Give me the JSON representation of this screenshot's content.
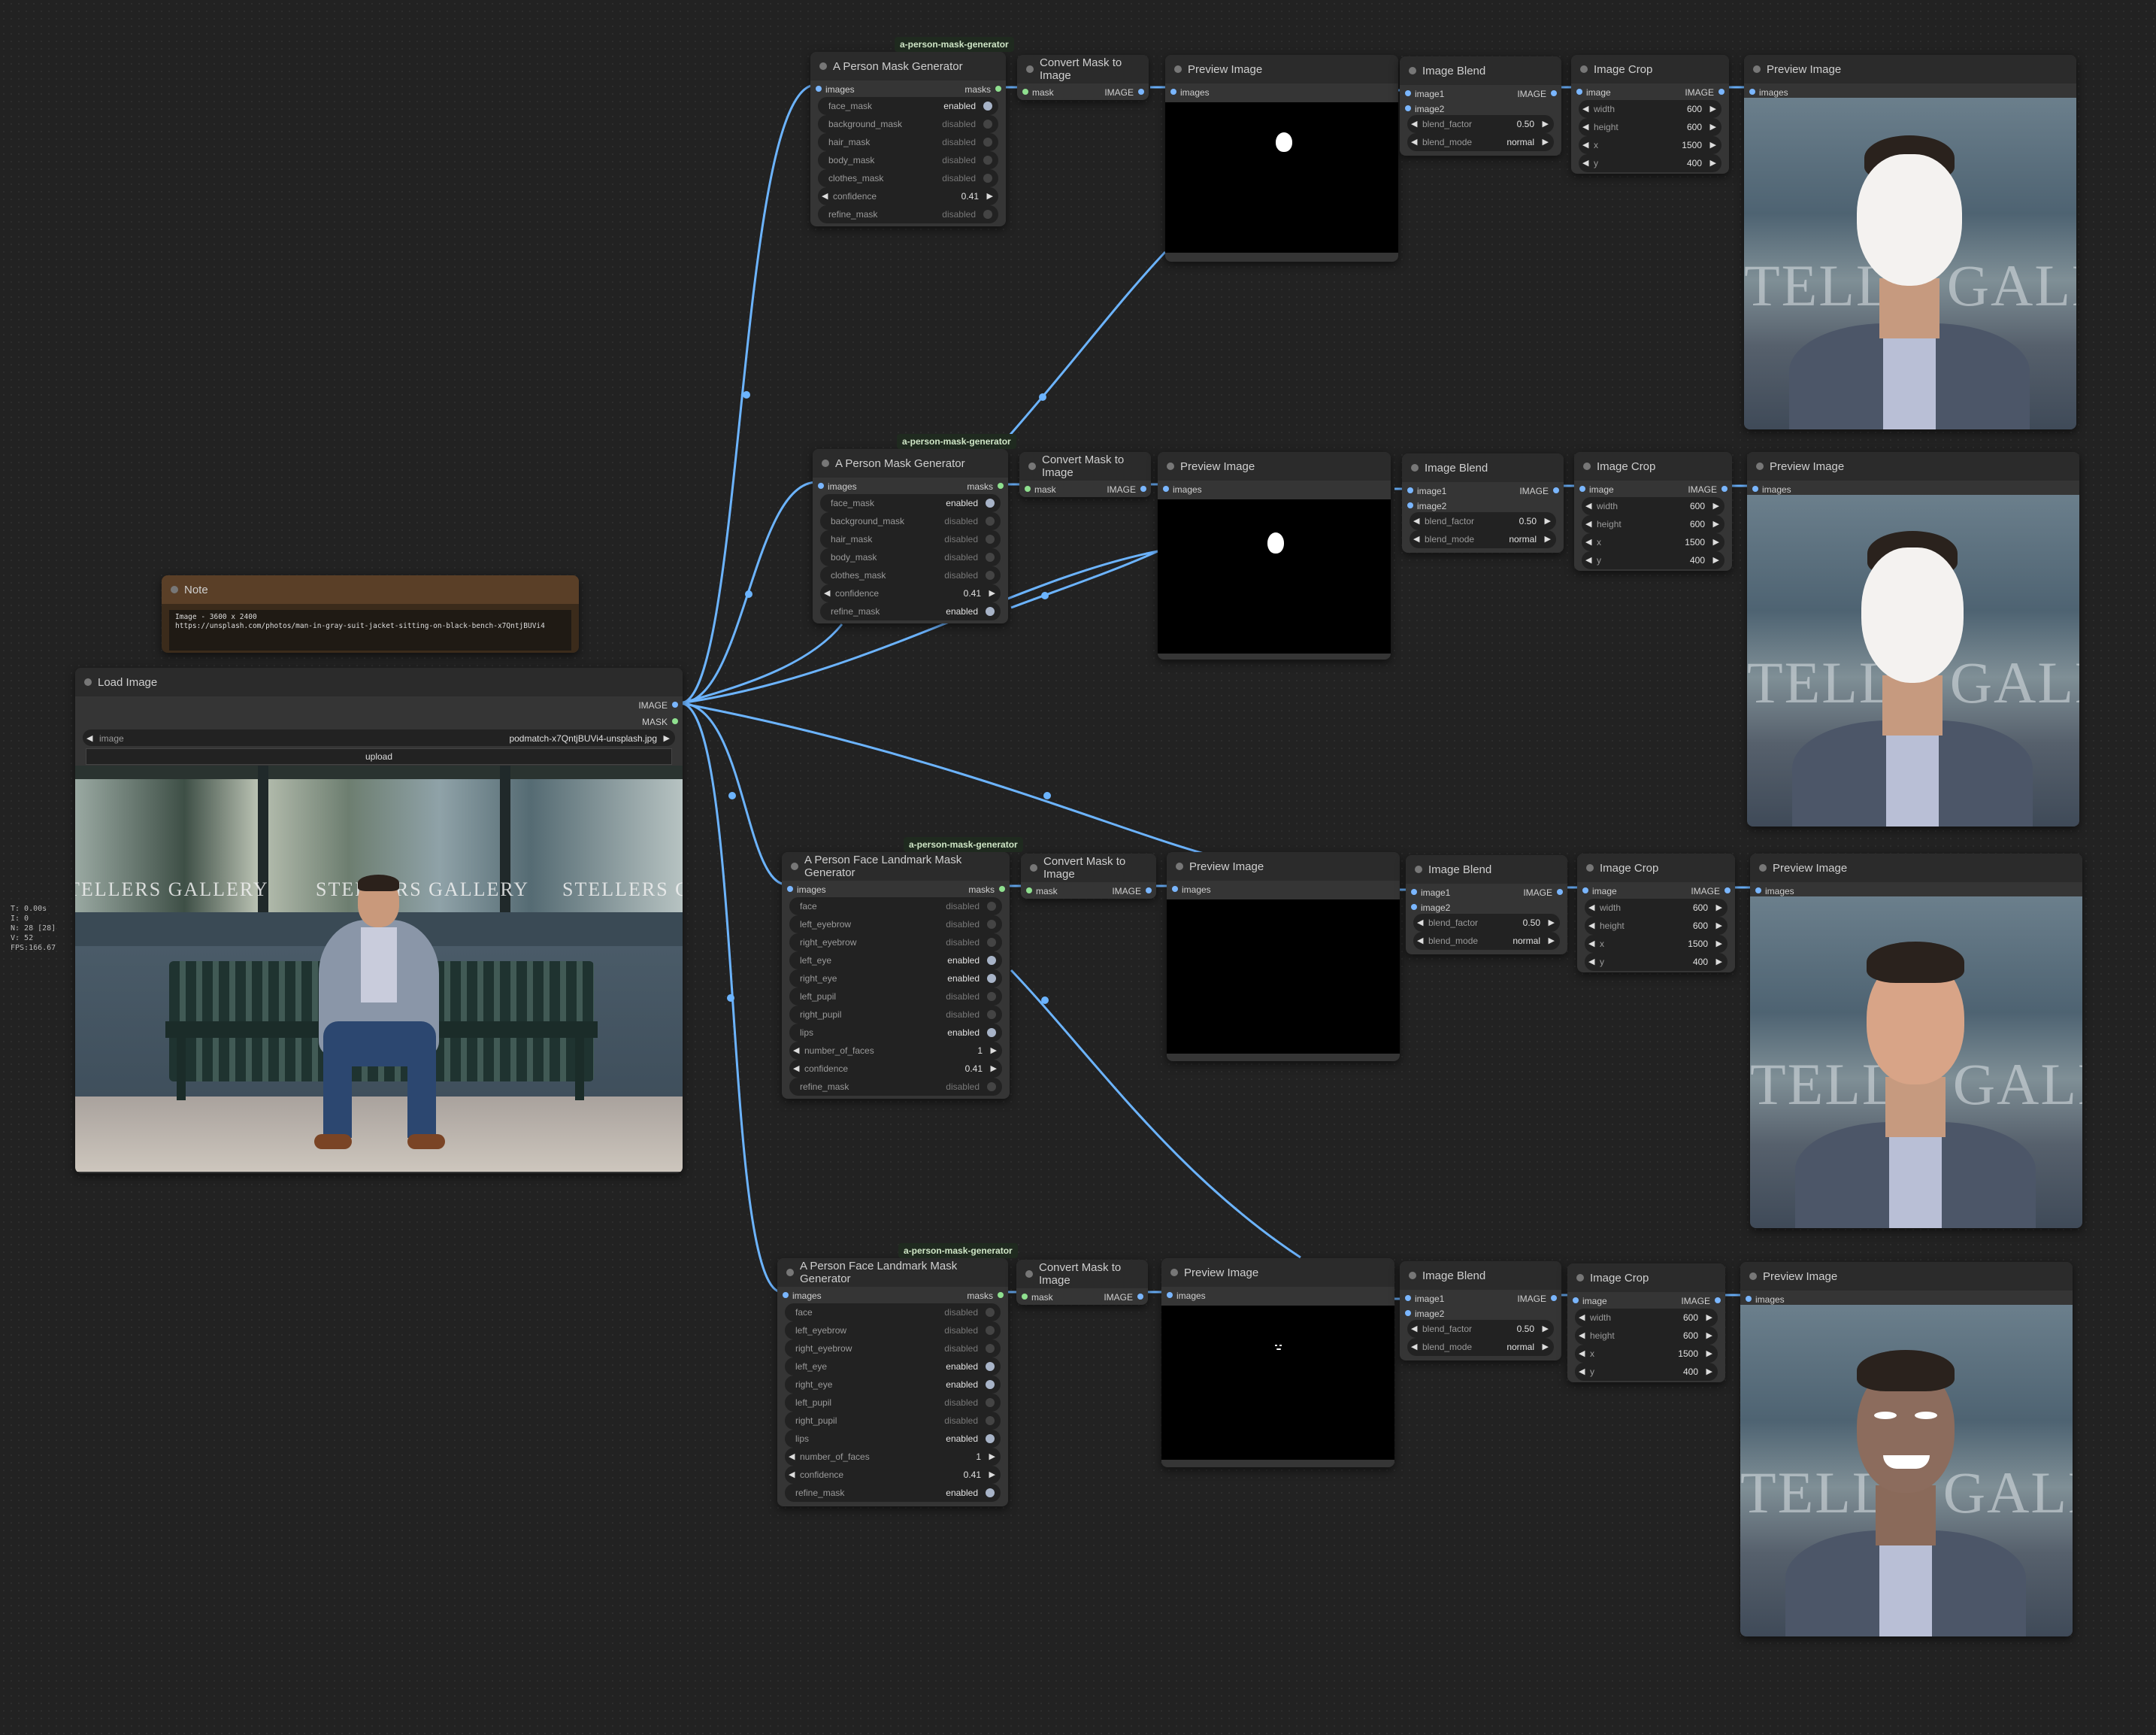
{
  "canvas_stats": [
    "T: 0.00s",
    "I: 0",
    "N: 28 [28]",
    "V: 52",
    "FPS:166.67"
  ],
  "badge_text": "a-person-mask-generator",
  "note": {
    "title": "Note",
    "line1": "Image - 3600 x 2400",
    "line2": "https://unsplash.com/photos/man-in-gray-suit-jacket-sitting-on-black-bench-x7QntjBUVi4"
  },
  "load_image": {
    "title": "Load Image",
    "out_image": "IMAGE",
    "out_mask": "MASK",
    "image_label": "image",
    "image_value": "podmatch-x7QntjBUVi4-unsplash.jpg",
    "upload_label": "upload",
    "photo_text": [
      "TELLERS GALLERY",
      "STELLERS GALLERY",
      "STELLERS GALL"
    ]
  },
  "mask_gen_1": {
    "title": "A Person Mask Generator",
    "in": "images",
    "out": "masks",
    "widgets": [
      {
        "k": "face_mask",
        "v": "enabled"
      },
      {
        "k": "background_mask",
        "v": "disabled"
      },
      {
        "k": "hair_mask",
        "v": "disabled"
      },
      {
        "k": "body_mask",
        "v": "disabled"
      },
      {
        "k": "clothes_mask",
        "v": "disabled"
      },
      {
        "k": "confidence",
        "v": "0.41",
        "num": true
      },
      {
        "k": "refine_mask",
        "v": "disabled"
      }
    ]
  },
  "mask_gen_2": {
    "title": "A Person Mask Generator",
    "in": "images",
    "out": "masks",
    "widgets": [
      {
        "k": "face_mask",
        "v": "enabled"
      },
      {
        "k": "background_mask",
        "v": "disabled"
      },
      {
        "k": "hair_mask",
        "v": "disabled"
      },
      {
        "k": "body_mask",
        "v": "disabled"
      },
      {
        "k": "clothes_mask",
        "v": "disabled"
      },
      {
        "k": "confidence",
        "v": "0.41",
        "num": true
      },
      {
        "k": "refine_mask",
        "v": "enabled"
      }
    ]
  },
  "landmark_gen_1": {
    "title": "A Person Face Landmark Mask Generator",
    "in": "images",
    "out": "masks",
    "widgets": [
      {
        "k": "face",
        "v": "disabled"
      },
      {
        "k": "left_eyebrow",
        "v": "disabled"
      },
      {
        "k": "right_eyebrow",
        "v": "disabled"
      },
      {
        "k": "left_eye",
        "v": "enabled"
      },
      {
        "k": "right_eye",
        "v": "enabled"
      },
      {
        "k": "left_pupil",
        "v": "disabled"
      },
      {
        "k": "right_pupil",
        "v": "disabled"
      },
      {
        "k": "lips",
        "v": "enabled"
      },
      {
        "k": "number_of_faces",
        "v": "1",
        "num": true
      },
      {
        "k": "confidence",
        "v": "0.41",
        "num": true
      },
      {
        "k": "refine_mask",
        "v": "disabled"
      }
    ]
  },
  "landmark_gen_2": {
    "title": "A Person Face Landmark Mask Generator",
    "in": "images",
    "out": "masks",
    "widgets": [
      {
        "k": "face",
        "v": "disabled"
      },
      {
        "k": "left_eyebrow",
        "v": "disabled"
      },
      {
        "k": "right_eyebrow",
        "v": "disabled"
      },
      {
        "k": "left_eye",
        "v": "enabled"
      },
      {
        "k": "right_eye",
        "v": "enabled"
      },
      {
        "k": "left_pupil",
        "v": "disabled"
      },
      {
        "k": "right_pupil",
        "v": "disabled"
      },
      {
        "k": "lips",
        "v": "enabled"
      },
      {
        "k": "number_of_faces",
        "v": "1",
        "num": true
      },
      {
        "k": "confidence",
        "v": "0.41",
        "num": true
      },
      {
        "k": "refine_mask",
        "v": "enabled"
      }
    ]
  },
  "convert": {
    "title": "Convert Mask to Image",
    "in": "mask",
    "out": "IMAGE"
  },
  "preview": {
    "title": "Preview Image",
    "in": "images"
  },
  "blend": {
    "title": "Image Blend",
    "in1": "image1",
    "in2": "image2",
    "out": "IMAGE",
    "blend_factor_k": "blend_factor",
    "blend_factor_v": "0.50",
    "blend_mode_k": "blend_mode",
    "blend_mode_v": "normal"
  },
  "crop": {
    "title": "Image Crop",
    "in": "image",
    "out": "IMAGE",
    "widgets": [
      {
        "k": "width",
        "v": "600"
      },
      {
        "k": "height",
        "v": "600"
      },
      {
        "k": "x",
        "v": "1500"
      },
      {
        "k": "y",
        "v": "400"
      }
    ]
  },
  "crop_photo_text": "TELLE GALL"
}
